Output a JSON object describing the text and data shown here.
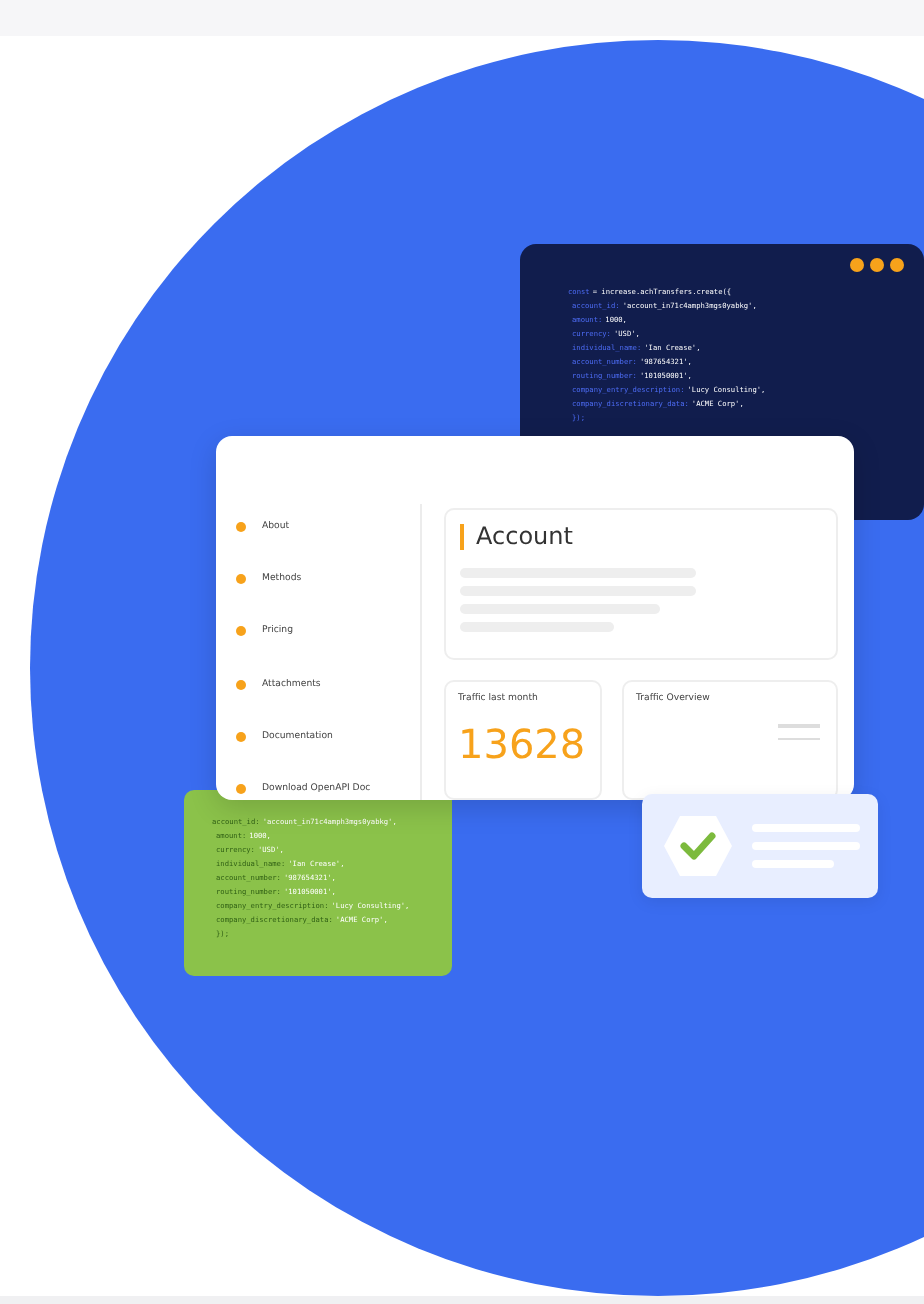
{
  "code_panel": {
    "lines": [
      {
        "key": "const",
        "value": "= increase.achTransfers.create({"
      },
      {
        "key": "account_id:",
        "value": "'account_in71c4amph3mgs0yabkg',"
      },
      {
        "key": "amount:",
        "value": "1000,"
      },
      {
        "key": "currency:",
        "value": "'USD',"
      },
      {
        "key": "individual_name:",
        "value": "'Ian Crease',"
      },
      {
        "key": "account_number:",
        "value": "'987654321',"
      },
      {
        "key": "routing_number:",
        "value": "'101050001',"
      },
      {
        "key": "company_entry_description:",
        "value": "'Lucy Consulting',"
      },
      {
        "key": "company_discretionary_data:",
        "value": "'ACME Corp',"
      },
      {
        "key": "});"
      }
    ]
  },
  "green_panel": {
    "lines": [
      {
        "key": "account_id:",
        "value": "'account_in71c4amph3mgs0yabkg',"
      },
      {
        "key": "amount:",
        "value": "1000,"
      },
      {
        "key": "currency:",
        "value": "'USD',"
      },
      {
        "key": "individual_name:",
        "value": "'Ian Crease',"
      },
      {
        "key": "account_number:",
        "value": "'987654321',"
      },
      {
        "key": "routing_number:",
        "value": "'101050001',"
      },
      {
        "key": "company_entry_description:",
        "value": "'Lucy Consulting',"
      },
      {
        "key": "company_discretionary_data:",
        "value": "'ACME Corp',"
      },
      {
        "key": "});"
      }
    ]
  },
  "sidebar": {
    "items": [
      "About",
      "Methods",
      "Pricing",
      "Attachments",
      "Documentation",
      "Download OpenAPI Doc"
    ]
  },
  "account": {
    "title": "Account"
  },
  "traffic": {
    "label": "Traffic last month",
    "value": "13628"
  },
  "overview": {
    "label": "Traffic Overview"
  }
}
